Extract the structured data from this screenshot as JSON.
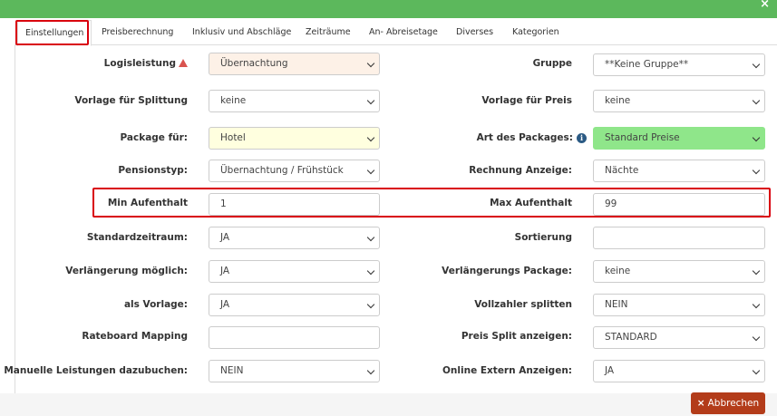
{
  "close_symbol": "×",
  "tabs": [
    {
      "label": "Einstellungen",
      "active": true
    },
    {
      "label": "Preisberechnung"
    },
    {
      "label": "Inklusiv und Abschläge"
    },
    {
      "label": "Zeiträume"
    },
    {
      "label": "An- Abreisetage"
    },
    {
      "label": "Diverses"
    },
    {
      "label": "Kategorien"
    }
  ],
  "left": {
    "logisleistung": {
      "label": "Logisleistung",
      "value": "Übernachtung",
      "bg": "#fdf1e7"
    },
    "vorlage_splittung": {
      "label": "Vorlage für Splittung",
      "value": "keine"
    },
    "package_fuer": {
      "label": "Package für:",
      "value": "Hotel",
      "bg": "#ffffdf"
    },
    "pensionstyp": {
      "label": "Pensionstyp:",
      "value": "Übernachtung / Frühstück"
    },
    "min_aufenthalt": {
      "label": "Min Aufenthalt",
      "value": "1"
    },
    "standardzeitraum": {
      "label": "Standardzeitraum:",
      "value": "JA"
    },
    "verlaengerung": {
      "label": "Verlängerung möglich:",
      "value": "JA"
    },
    "als_vorlage": {
      "label": "als Vorlage:",
      "value": "JA"
    },
    "rateboard": {
      "label": "Rateboard Mapping",
      "value": ""
    },
    "manuelle": {
      "label": "Manuelle Leistungen dazubuchen:",
      "value": "NEIN"
    }
  },
  "right": {
    "gruppe": {
      "label": "Gruppe",
      "value": "**Keine Gruppe**"
    },
    "vorlage_preis": {
      "label": "Vorlage für Preis",
      "value": "keine"
    },
    "art_packages": {
      "label": "Art des Packages:",
      "value": "Standard Preise",
      "bg": "#8fe68a"
    },
    "rechnung": {
      "label": "Rechnung Anzeige:",
      "value": "Nächte"
    },
    "max_aufenthalt": {
      "label": "Max Aufenthalt",
      "value": "99"
    },
    "sortierung": {
      "label": "Sortierung",
      "value": ""
    },
    "verlaengerungs_package": {
      "label": "Verlängerungs Package:",
      "value": "keine"
    },
    "vollzahler": {
      "label": "Vollzahler splitten",
      "value": "NEIN"
    },
    "preis_split": {
      "label": "Preis Split anzeigen:",
      "value": "STANDARD"
    },
    "online_extern": {
      "label": "Online Extern Anzeigen:",
      "value": "JA"
    }
  },
  "footer": {
    "cancel_label": "Abbrechen",
    "cancel_icon": "×"
  },
  "colors": {
    "header": "#5cb85c",
    "highlight": "#d9000d",
    "cancel": "#b33c1a"
  }
}
